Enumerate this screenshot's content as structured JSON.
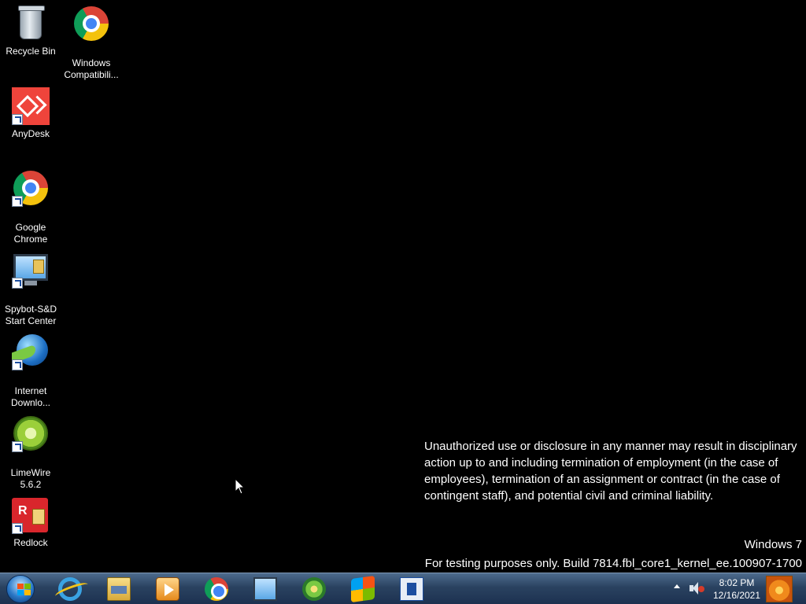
{
  "desktop": {
    "icons": [
      {
        "label": "Recycle Bin",
        "icon": "recycle-bin-icon"
      },
      {
        "label": "Windows\nCompatibili...",
        "icon": "chrome-icon"
      },
      {
        "label": "AnyDesk",
        "icon": "anydesk-icon"
      },
      {
        "label": "Google\nChrome",
        "icon": "chrome-icon"
      },
      {
        "label": "Spybot-S&D\nStart Center",
        "icon": "spybot-icon"
      },
      {
        "label": "Internet\nDownlo...",
        "icon": "internet-download-manager-icon"
      },
      {
        "label": "LimeWire\n5.6.2",
        "icon": "limewire-icon"
      },
      {
        "label": "Redlock",
        "icon": "redlock-icon"
      }
    ],
    "legal_notice": "Unauthorized use or disclosure in any manner may result in disciplinary action up to and including termination of employment (in the case of employees), termination of an assignment or contract (in the case of contingent staff), and potential civil and criminal liability.",
    "os_name": "Windows 7",
    "build_info": "For testing purposes only. Build 7814.fbl_core1_kernel_ee.100907-1700"
  },
  "taskbar": {
    "pinned": [
      {
        "icon": "internet-explorer-icon"
      },
      {
        "icon": "file-explorer-icon"
      },
      {
        "icon": "windows-media-player-icon"
      },
      {
        "icon": "chrome-icon"
      },
      {
        "icon": "network-icon"
      },
      {
        "icon": "windows-ball-icon"
      },
      {
        "icon": "windows-flag-icon"
      },
      {
        "icon": "terminal-icon"
      }
    ],
    "clock": {
      "time": "8:02 PM",
      "date": "12/16/2021"
    }
  }
}
